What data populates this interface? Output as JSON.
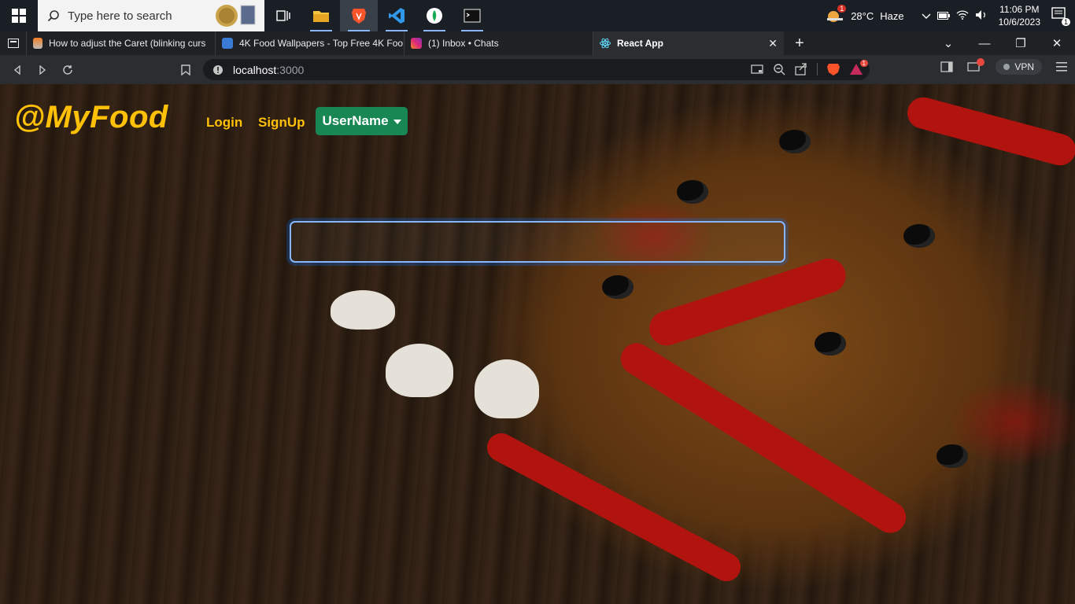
{
  "taskbar": {
    "search_placeholder": "Type here to search",
    "weather_temp": "28°C",
    "weather_cond": "Haze",
    "weather_badge": "1",
    "time": "11:06 PM",
    "date": "10/6/2023",
    "notification_count": "1",
    "apps": [
      "task-view",
      "file-explorer",
      "brave-browser",
      "vscode",
      "mongodb-compass",
      "terminal"
    ]
  },
  "browser": {
    "tabs": [
      {
        "title": "How to adjust the Caret (blinking curs",
        "icon": "stackoverflow-icon"
      },
      {
        "title": "4K Food Wallpapers - Top Free 4K Foo",
        "icon": "wallpapers-icon"
      },
      {
        "title": "(1) Inbox • Chats",
        "icon": "instagram-icon"
      },
      {
        "title": "React App",
        "icon": "react-icon",
        "active": true
      }
    ],
    "url_host": "localhost",
    "url_port": ":3000",
    "vpn_label": "VPN",
    "alert_badge": "1"
  },
  "page": {
    "brand": "@MyFood",
    "nav": {
      "login": "Login",
      "signup": "SignUp",
      "user": "UserName"
    },
    "search": {
      "value": "",
      "placeholder": ""
    }
  },
  "colors": {
    "brand": "#ffc107",
    "user_button": "#198754",
    "focus_ring": "#86b7fe"
  }
}
